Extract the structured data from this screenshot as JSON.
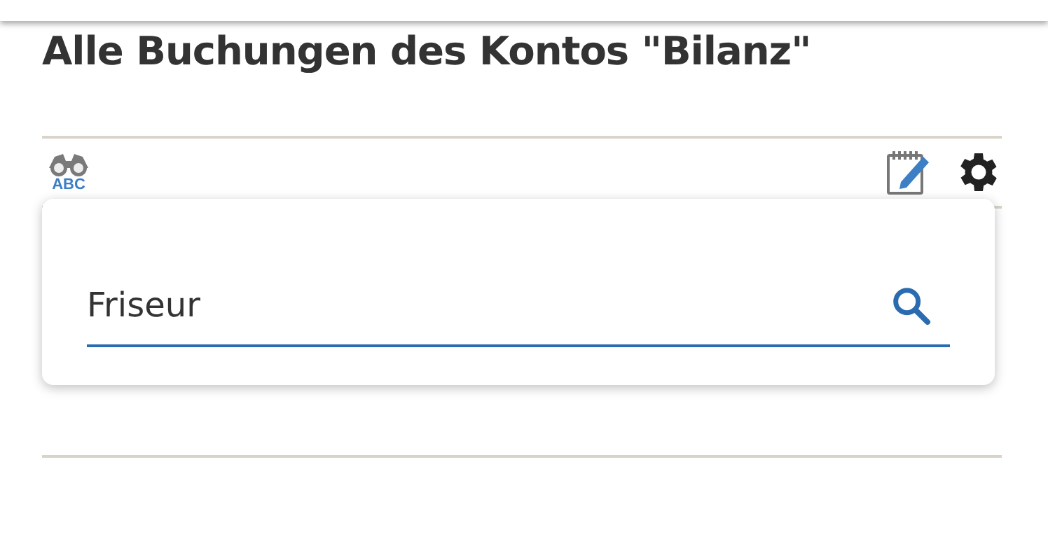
{
  "title": "Alle Buchungen des Kontos \"Bilanz\"",
  "toolbar": {
    "search_badge": "ABC"
  },
  "search_popup": {
    "value": "Friseur"
  }
}
